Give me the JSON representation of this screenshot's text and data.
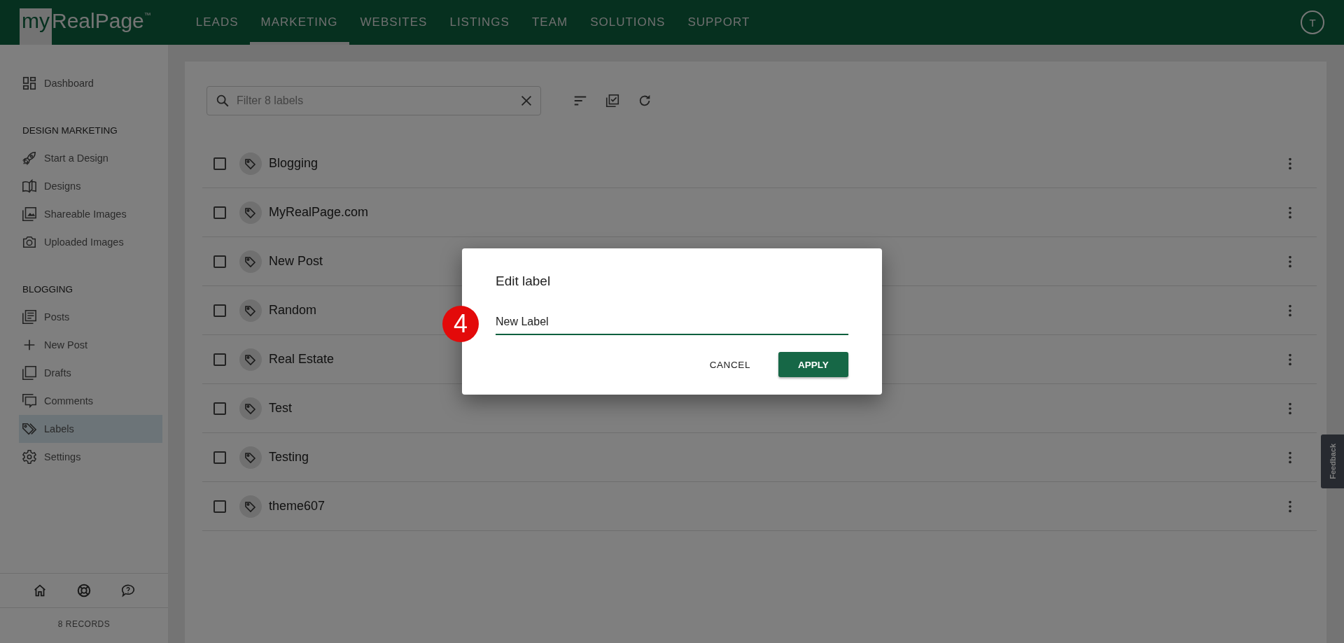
{
  "header": {
    "logo_prefix": "my",
    "logo_name": "RealPage",
    "logo_mark": "™",
    "avatar": "T",
    "nav": [
      {
        "label": "LEADS",
        "selected": false
      },
      {
        "label": "MARKETING",
        "selected": true
      },
      {
        "label": "WEBSITES",
        "selected": false
      },
      {
        "label": "LISTINGS",
        "selected": false
      },
      {
        "label": "TEAM",
        "selected": false
      },
      {
        "label": "SOLUTIONS",
        "selected": false
      },
      {
        "label": "SUPPORT",
        "selected": false
      }
    ]
  },
  "sidebar": {
    "sections": [
      {
        "items": [
          {
            "label": "Dashboard",
            "kind": "dashboard",
            "selected": false
          }
        ]
      },
      {
        "title": "DESIGN MARKETING",
        "items": [
          {
            "label": "Start a Design",
            "kind": "rocket",
            "selected": false
          },
          {
            "label": "Designs",
            "kind": "book",
            "selected": false
          },
          {
            "label": "Shareable Images",
            "kind": "images",
            "selected": false
          },
          {
            "label": "Uploaded Images",
            "kind": "camera",
            "selected": false
          }
        ]
      },
      {
        "title": "BLOGGING",
        "items": [
          {
            "label": "Posts",
            "kind": "posts",
            "selected": false
          },
          {
            "label": "New Post",
            "kind": "plus",
            "selected": false
          },
          {
            "label": "Drafts",
            "kind": "drafts",
            "selected": false
          },
          {
            "label": "Comments",
            "kind": "comments",
            "selected": false
          },
          {
            "label": "Labels",
            "kind": "labels",
            "selected": true
          },
          {
            "label": "Settings",
            "kind": "settings",
            "selected": false
          }
        ]
      }
    ],
    "footer_count": "8 RECORDS"
  },
  "filter": {
    "placeholder": "Filter 8 labels"
  },
  "labels": [
    {
      "name": "Blogging",
      "checked": false
    },
    {
      "name": "MyRealPage.com",
      "checked": false
    },
    {
      "name": "New Post",
      "checked": false
    },
    {
      "name": "Random",
      "checked": false
    },
    {
      "name": "Real Estate",
      "checked": false
    },
    {
      "name": "Test",
      "checked": false
    },
    {
      "name": "Testing",
      "checked": false
    },
    {
      "name": "theme607",
      "checked": false
    }
  ],
  "dialog": {
    "title": "Edit label",
    "value": "New Label",
    "step_badge": "4",
    "cancel": "CANCEL",
    "apply": "APPLY"
  },
  "feedback": "Feedback"
}
